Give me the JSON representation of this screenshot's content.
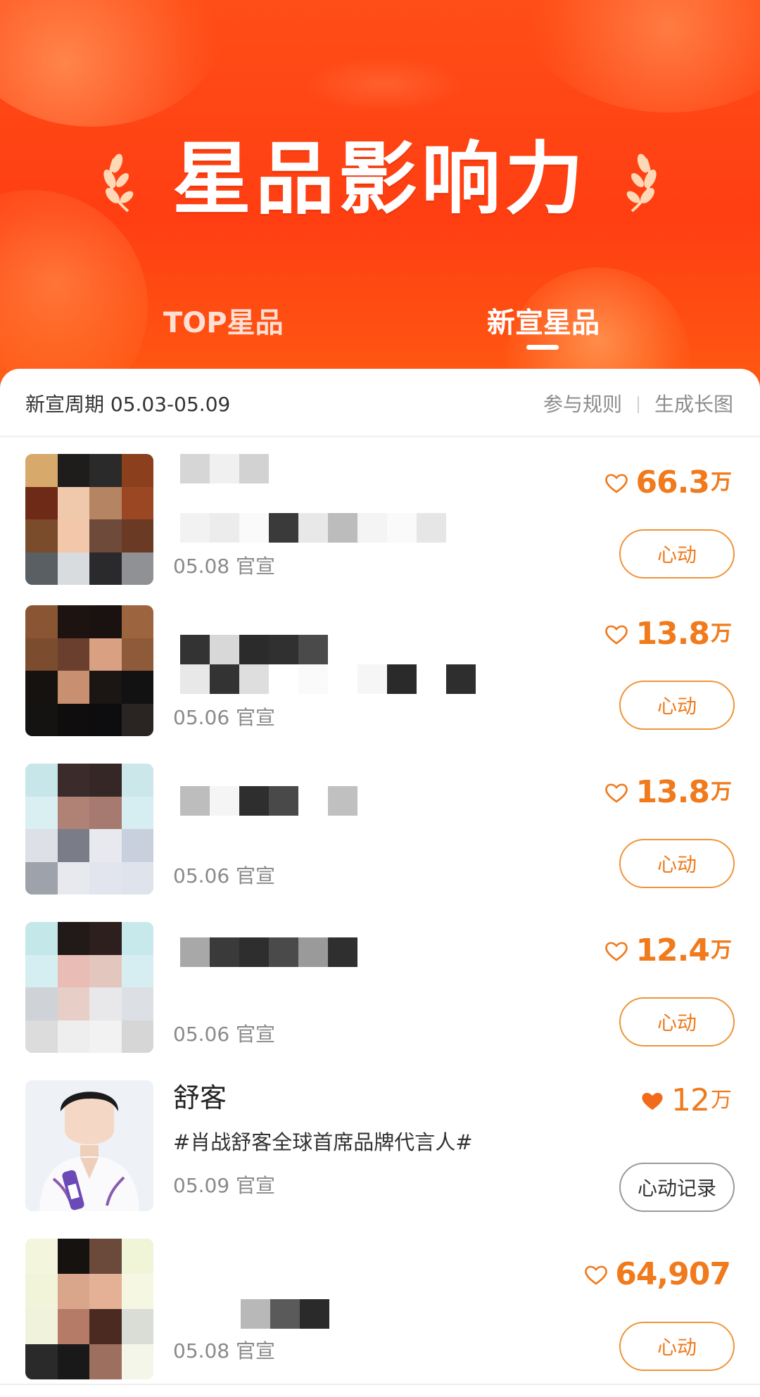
{
  "header": {
    "title": "星品影响力",
    "tabs": [
      {
        "label": "TOP星品",
        "active": false
      },
      {
        "label": "新宣星品",
        "active": true
      }
    ]
  },
  "toolbar": {
    "period": "新宣周期 05.03-05.09",
    "rules_label": "参与规则",
    "poster_label": "生成长图"
  },
  "colors": {
    "accent": "#f07a1c",
    "header_bg": "#ff4a16"
  },
  "items": [
    {
      "name": "",
      "hashtag": "",
      "date": "05.08 官宣",
      "likes": "66.3",
      "unit": "万",
      "button": "心动",
      "liked": false
    },
    {
      "name": "",
      "hashtag": "",
      "date": "05.06 官宣",
      "likes": "13.8",
      "unit": "万",
      "button": "心动",
      "liked": false
    },
    {
      "name": "",
      "hashtag": "",
      "date": "05.06 官宣",
      "likes": "13.8",
      "unit": "万",
      "button": "心动",
      "liked": false
    },
    {
      "name": "",
      "hashtag": "",
      "date": "05.06 官宣",
      "likes": "12.4",
      "unit": "万",
      "button": "心动",
      "liked": false
    },
    {
      "name": "舒客",
      "hashtag": "#肖战舒客全球首席品牌代言人#",
      "date": "05.09 官宣",
      "likes": "12",
      "unit": "万",
      "button": "心动记录",
      "liked": true
    },
    {
      "name": "",
      "hashtag": "",
      "date": "05.08 官宣",
      "likes": "64,907",
      "unit": "",
      "button": "心动",
      "liked": false
    }
  ]
}
